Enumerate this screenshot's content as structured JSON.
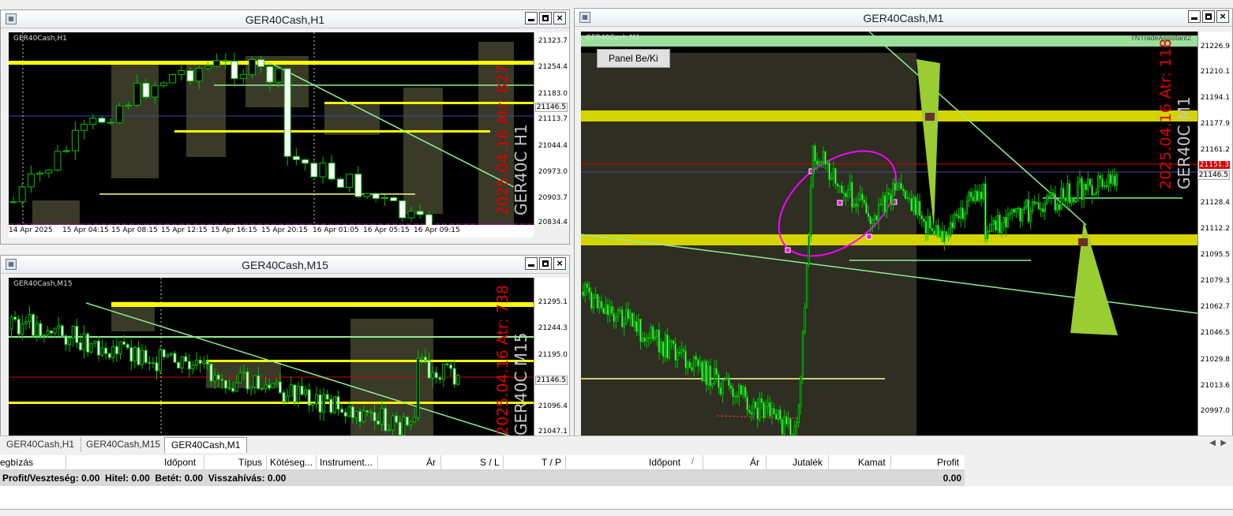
{
  "windows": {
    "h1": {
      "title": "GER40Cash,H1",
      "symbol_label": "GER40Cash,H1",
      "vertical_label": "GER40C H1",
      "vertical_red": "2025.04.16 Atr: 827",
      "price_ticks": [
        "21323.7",
        "21254.4",
        "21183.0",
        "21146.5",
        "21113.7",
        "21044.4",
        "20973.0",
        "20903.7",
        "20834.4"
      ],
      "time_ticks": [
        "14 Apr 2025",
        "15 Apr 04:15",
        "15 Apr 08:15",
        "15 Apr 12:15",
        "15 Apr 16:15",
        "15 Apr 20:15",
        "16 Apr 01:05",
        "16 Apr 05:15",
        "16 Apr 09:15"
      ]
    },
    "m15": {
      "title": "GER40Cash,M15",
      "symbol_label": "GER40Cash,M15",
      "vertical_label": "GER40C M15",
      "vertical_red": "2025.04.16 Atr: 738",
      "price_ticks": [
        "21295.1",
        "21244.3",
        "21195.0",
        "21146.5",
        "21096.4",
        "21047.1"
      ]
    },
    "m1": {
      "title": "GER40Cash,M1",
      "symbol_label": "GER40Cash,M1",
      "vertical_label": "GER40C M1",
      "vertical_red": "2025.04.16 Atr: 118",
      "top_right_label": "TNTradeAssistant2",
      "panel_button": "Panel Be/Ki",
      "price_ticks": [
        "21226.9",
        "21210.1",
        "21194.1",
        "21177.9",
        "21161.2",
        "21151.3",
        "21146.5",
        "21128.4",
        "21112.2",
        "21095.5",
        "21079.3",
        "21062.7",
        "21046.5",
        "21029.8",
        "21013.6",
        "20997.0"
      ]
    }
  },
  "tabs": [
    "GER40Cash,H1",
    "GER40Cash,M15",
    "GER40Cash,M1"
  ],
  "terminal": {
    "headers": [
      "egbízás",
      "Időpont",
      "Típus",
      "Kötéseg...",
      "Instrument...",
      "Ár",
      "S / L",
      "T / P",
      "Időpont",
      "Ár",
      "Jutalék",
      "Kamat",
      "Profit"
    ],
    "balance_text": "Profit/Veszteség: 0.00  Hitel: 0.00  Betét: 0.00  Visszahívás: 0.00",
    "balance_profit": "0.00"
  },
  "colors": {
    "bull": "#00c000",
    "bear": "#ffffff",
    "level_yellow": "#ffff00",
    "zone": "#3a3a28",
    "trend": "#90ee90",
    "ellipse": "#ff00ff",
    "wedge": "#9acd32",
    "red_text": "#e00000"
  }
}
